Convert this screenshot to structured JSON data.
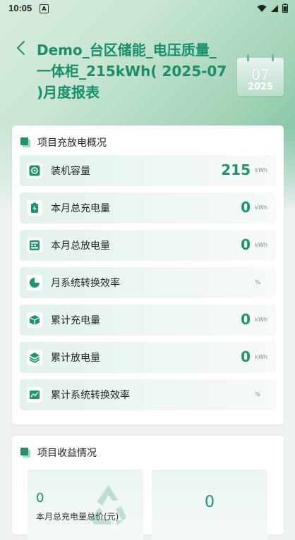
{
  "status": {
    "time": "10:05",
    "badge": "A"
  },
  "header": {
    "title": "Demo_台区储能_电压质量_一体柜_215kWh( 2025-07 )月度报表",
    "date_month": "07",
    "date_year": "2025"
  },
  "overview": {
    "section_title": "项目充放电概况",
    "rows": [
      {
        "label": "装机容量",
        "value": "215",
        "unit": "kWh",
        "icon": "gear-icon"
      },
      {
        "label": "本月总充电量",
        "value": "0",
        "unit": "kWh",
        "icon": "battery-charge-icon"
      },
      {
        "label": "本月总放电量",
        "value": "0",
        "unit": "kWh",
        "icon": "discharge-icon"
      },
      {
        "label": "月系统转换效率",
        "value": "",
        "unit": "%",
        "icon": "pie-chart-icon"
      },
      {
        "label": "累计充电量",
        "value": "0",
        "unit": "kWh",
        "icon": "cube-icon"
      },
      {
        "label": "累计放电量",
        "value": "0",
        "unit": "kWh",
        "icon": "layers-icon"
      },
      {
        "label": "累计系统转换效率",
        "value": "",
        "unit": "%",
        "icon": "trend-chart-icon"
      }
    ]
  },
  "income": {
    "section_title": "项目收益情况",
    "card1_value": "0",
    "card1_caption": "本月总充电量总价(元)",
    "card2_value": "0"
  },
  "colors": {
    "accent": "#17976d",
    "title": "#16906a"
  }
}
